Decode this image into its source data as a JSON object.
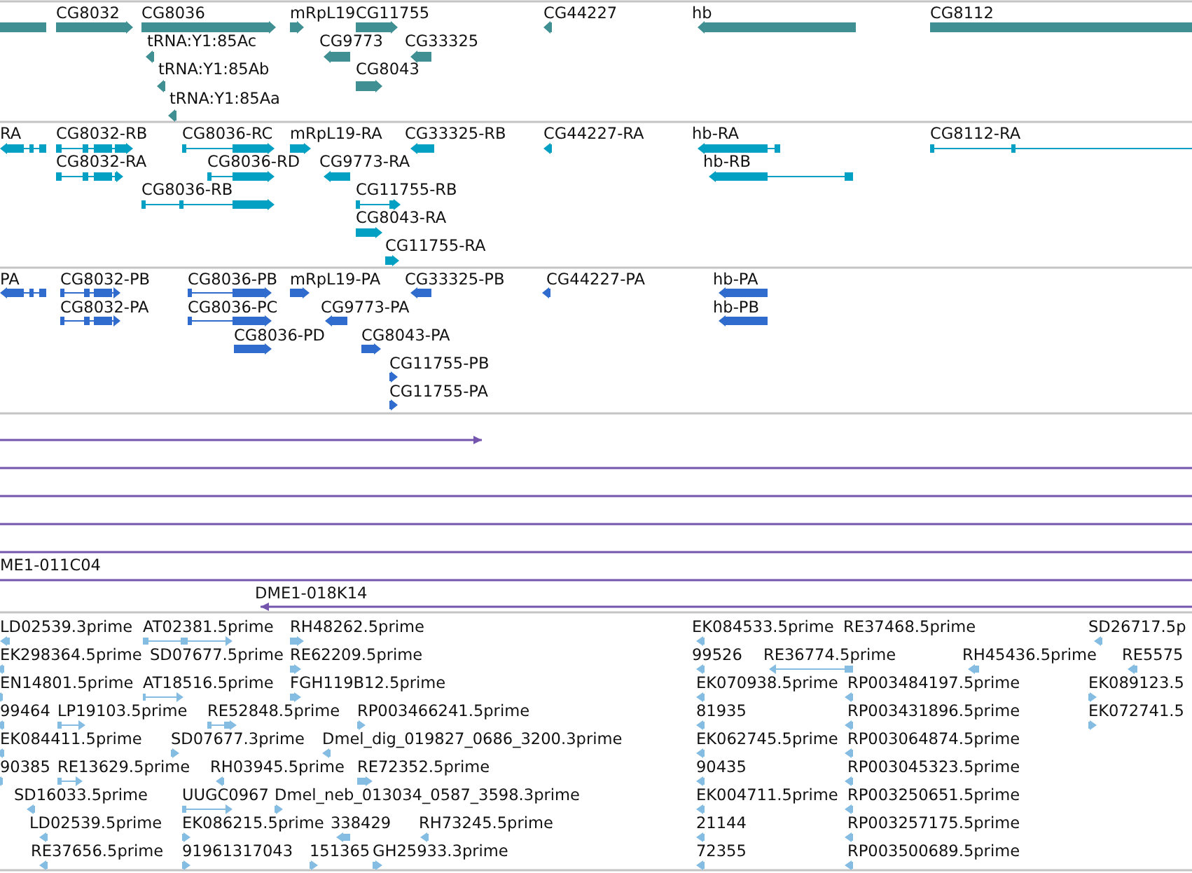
{
  "tracks": [
    {
      "kind": "gene",
      "features": [
        {
          "arrowhead": false
        },
        {
          "label": "CG8032",
          "arrowhead": true,
          "reverse": false
        },
        {
          "label": "CG8036",
          "arrowhead": true,
          "reverse": false
        },
        {
          "label": "mRpL19",
          "arrowhead": true,
          "reverse": false
        },
        {
          "label": "CG11755",
          "arrowhead": true,
          "reverse": false
        },
        {
          "label": "tRNA:Y1:85Ac",
          "arrowhead": true,
          "reverse": true
        },
        {
          "label": "CG9773",
          "arrowhead": true,
          "reverse": true
        },
        {
          "label": "CG33325",
          "arrowhead": true,
          "reverse": true
        },
        {
          "label": "tRNA:Y1:85Ab",
          "arrowhead": true,
          "reverse": true
        },
        {
          "label": "CG8043",
          "arrowhead": true,
          "reverse": false
        },
        {
          "label": "tRNA:Y1:85Aa",
          "arrowhead": true,
          "reverse": true
        },
        {
          "label": "CG44227",
          "arrowhead": true,
          "reverse": true
        },
        {
          "label": "hb",
          "arrowhead": true,
          "reverse": true
        },
        {
          "label": "CG8112",
          "arrowhead": false
        }
      ]
    },
    {
      "kind": "transcript",
      "features": [
        {
          "label": "RA",
          "arrowhead": true,
          "reverse": true
        },
        {
          "label": "CG8032-RB",
          "arrowhead": true,
          "reverse": false
        },
        {
          "label": "CG8036-RC",
          "arrowhead": true,
          "reverse": false
        },
        {
          "label": "mRpL19-RA",
          "arrowhead": true,
          "reverse": false
        },
        {
          "label": "CG33325-RB",
          "arrowhead": true,
          "reverse": true
        },
        {
          "label": "CG44227-RA",
          "arrowhead": true,
          "reverse": true
        },
        {
          "label": "hb-RA",
          "arrowhead": true,
          "reverse": true
        },
        {
          "label": "CG8112-RA",
          "arrowhead": false
        },
        {
          "label": "CG8032-RA",
          "arrowhead": true,
          "reverse": false
        },
        {
          "label": "CG8036-RD",
          "arrowhead": true,
          "reverse": false
        },
        {
          "label": "CG9773-RA",
          "arrowhead": true,
          "reverse": true
        },
        {
          "label": "hb-RB",
          "arrowhead": true,
          "reverse": true
        },
        {
          "label": "CG8036-RB",
          "arrowhead": true,
          "reverse": false
        },
        {
          "label": "CG11755-RB",
          "arrowhead": true,
          "reverse": false
        },
        {
          "label": "CG8043-RA",
          "arrowhead": true,
          "reverse": false
        },
        {
          "label": "CG11755-RA",
          "arrowhead": true,
          "reverse": false
        }
      ]
    },
    {
      "kind": "protein",
      "features": [
        {
          "label": "PA",
          "arrowhead": true,
          "reverse": true
        },
        {
          "label": "CG8032-PB",
          "arrowhead": true,
          "reverse": false
        },
        {
          "label": "CG8036-PB",
          "arrowhead": true,
          "reverse": false
        },
        {
          "label": "mRpL19-PA",
          "arrowhead": true,
          "reverse": false
        },
        {
          "label": "CG33325-PB",
          "arrowhead": true,
          "reverse": true
        },
        {
          "label": "CG44227-PA",
          "arrowhead": true,
          "reverse": true
        },
        {
          "label": "hb-PA",
          "arrowhead": true,
          "reverse": true
        },
        {
          "label": "CG8032-PA",
          "arrowhead": true,
          "reverse": false
        },
        {
          "label": "CG8036-PC",
          "arrowhead": true,
          "reverse": false
        },
        {
          "label": "CG9773-PA",
          "arrowhead": true,
          "reverse": true
        },
        {
          "label": "hb-PB",
          "arrowhead": true,
          "reverse": true
        },
        {
          "label": "CG8036-PD",
          "arrowhead": true,
          "reverse": false
        },
        {
          "label": "CG8043-PA",
          "arrowhead": true,
          "reverse": false
        },
        {
          "label": "CG11755-PB",
          "arrowhead": true,
          "reverse": false
        },
        {
          "label": "CG11755-PA",
          "arrowhead": true,
          "reverse": false
        }
      ]
    },
    {
      "kind": "clone",
      "features": [
        {
          "arrowhead": true,
          "reverse": false
        },
        {
          "arrowhead": false
        },
        {
          "arrowhead": false
        },
        {
          "arrowhead": false
        },
        {
          "arrowhead": false
        },
        {
          "label": "ME1-011C04",
          "arrowhead": false
        },
        {
          "label": "DME1-018K14",
          "arrowhead": true,
          "reverse": true
        }
      ]
    },
    {
      "kind": "est",
      "features": [
        {
          "label": "LD02539.3prime",
          "arrowhead": true,
          "reverse": true
        },
        {
          "label": "AT02381.5prime",
          "arrowhead": true,
          "reverse": false
        },
        {
          "label": "RH48262.5prime",
          "arrowhead": true,
          "reverse": false
        },
        {
          "label": "EK084533.5prime",
          "arrowhead": true,
          "reverse": true
        },
        {
          "label": "RE37468.5prime"
        },
        {
          "label": "SD26717.5p",
          "arrowhead": true,
          "reverse": true
        },
        {
          "label": "EK298364.5prime",
          "arrowhead": true,
          "reverse": true
        },
        {
          "label": "SD07677.5prime"
        },
        {
          "label": "RE62209.5prime",
          "arrowhead": true,
          "reverse": false
        },
        {
          "label": "99526",
          "arrowhead": true,
          "reverse": true
        },
        {
          "label": "RE36774.5prime",
          "arrowhead": true,
          "reverse": true
        },
        {
          "label": "RH45436.5prime",
          "arrowhead": true,
          "reverse": true
        },
        {
          "label": "RE5575",
          "arrowhead": true,
          "reverse": true
        },
        {
          "label": "EN14801.5prime",
          "arrowhead": true,
          "reverse": true
        },
        {
          "label": "AT18516.5prime",
          "arrowhead": true,
          "reverse": false
        },
        {
          "label": "FGH119B12.5prime",
          "arrowhead": true,
          "reverse": false
        },
        {
          "label": "EK070938.5prime",
          "arrowhead": true,
          "reverse": true
        },
        {
          "label": "RP003484197.5prime",
          "arrowhead": true,
          "reverse": true
        },
        {
          "label": "EK089123.5",
          "arrowhead": true,
          "reverse": false
        },
        {
          "label": "99464",
          "arrowhead": true,
          "reverse": true
        },
        {
          "label": "LP19103.5prime",
          "arrowhead": true,
          "reverse": false
        },
        {
          "label": "RE52848.5prime",
          "arrowhead": true,
          "reverse": false
        },
        {
          "label": "RP003466241.5prime",
          "arrowhead": true,
          "reverse": false
        },
        {
          "label": "81935",
          "arrowhead": true,
          "reverse": true
        },
        {
          "label": "RP003431896.5prime",
          "arrowhead": true,
          "reverse": true
        },
        {
          "label": "EK072741.5",
          "arrowhead": true,
          "reverse": false
        },
        {
          "label": "EK084411.5prime",
          "arrowhead": true,
          "reverse": true
        },
        {
          "label": "SD07677.3prime",
          "arrowhead": true,
          "reverse": false
        },
        {
          "label": "Dmel_dig_019827_0686_3200.3prime",
          "arrowhead": true,
          "reverse": true
        },
        {
          "label": "EK062745.5prime",
          "arrowhead": true,
          "reverse": true
        },
        {
          "label": "RP003064874.5prime",
          "arrowhead": true,
          "reverse": true
        },
        {
          "label": "90385",
          "arrowhead": true,
          "reverse": true
        },
        {
          "label": "RE13629.5prime",
          "arrowhead": true,
          "reverse": false
        },
        {
          "label": "RH03945.5prime",
          "arrowhead": true,
          "reverse": true
        },
        {
          "label": "RE72352.5prime",
          "arrowhead": true,
          "reverse": false
        },
        {
          "label": "90435",
          "arrowhead": true,
          "reverse": true
        },
        {
          "label": "RP003045323.5prime",
          "arrowhead": true,
          "reverse": true
        },
        {
          "label": "SD16033.5prime",
          "arrowhead": true,
          "reverse": true
        },
        {
          "label": "UUGC0967",
          "arrowhead": true,
          "reverse": false
        },
        {
          "label": "Dmel_neb_013034_0587_3598.3prime",
          "arrowhead": true,
          "reverse": false
        },
        {
          "label": "EK004711.5prime",
          "arrowhead": true,
          "reverse": true
        },
        {
          "label": "RP003250651.5prime",
          "arrowhead": true,
          "reverse": true
        },
        {
          "label": "LD02539.5prime",
          "arrowhead": true,
          "reverse": true
        },
        {
          "label": "EK086215.5prime",
          "arrowhead": true,
          "reverse": false
        },
        {
          "label": "338429",
          "arrowhead": true,
          "reverse": true
        },
        {
          "label": "RH73245.5prime",
          "arrowhead": true,
          "reverse": true
        },
        {
          "label": "21144",
          "arrowhead": true,
          "reverse": true
        },
        {
          "label": "RP003257175.5prime",
          "arrowhead": true,
          "reverse": true
        },
        {
          "label": "RE37656.5prime",
          "arrowhead": true,
          "reverse": true
        },
        {
          "label": "91961317043",
          "arrowhead": true,
          "reverse": false
        },
        {
          "label": "151365",
          "arrowhead": true,
          "reverse": false
        },
        {
          "label": "GH25933.3prime",
          "arrowhead": true,
          "reverse": false
        },
        {
          "label": "72355",
          "arrowhead": true,
          "reverse": true
        },
        {
          "label": "RP003500689.5prime",
          "arrowhead": true,
          "reverse": true
        }
      ]
    }
  ]
}
